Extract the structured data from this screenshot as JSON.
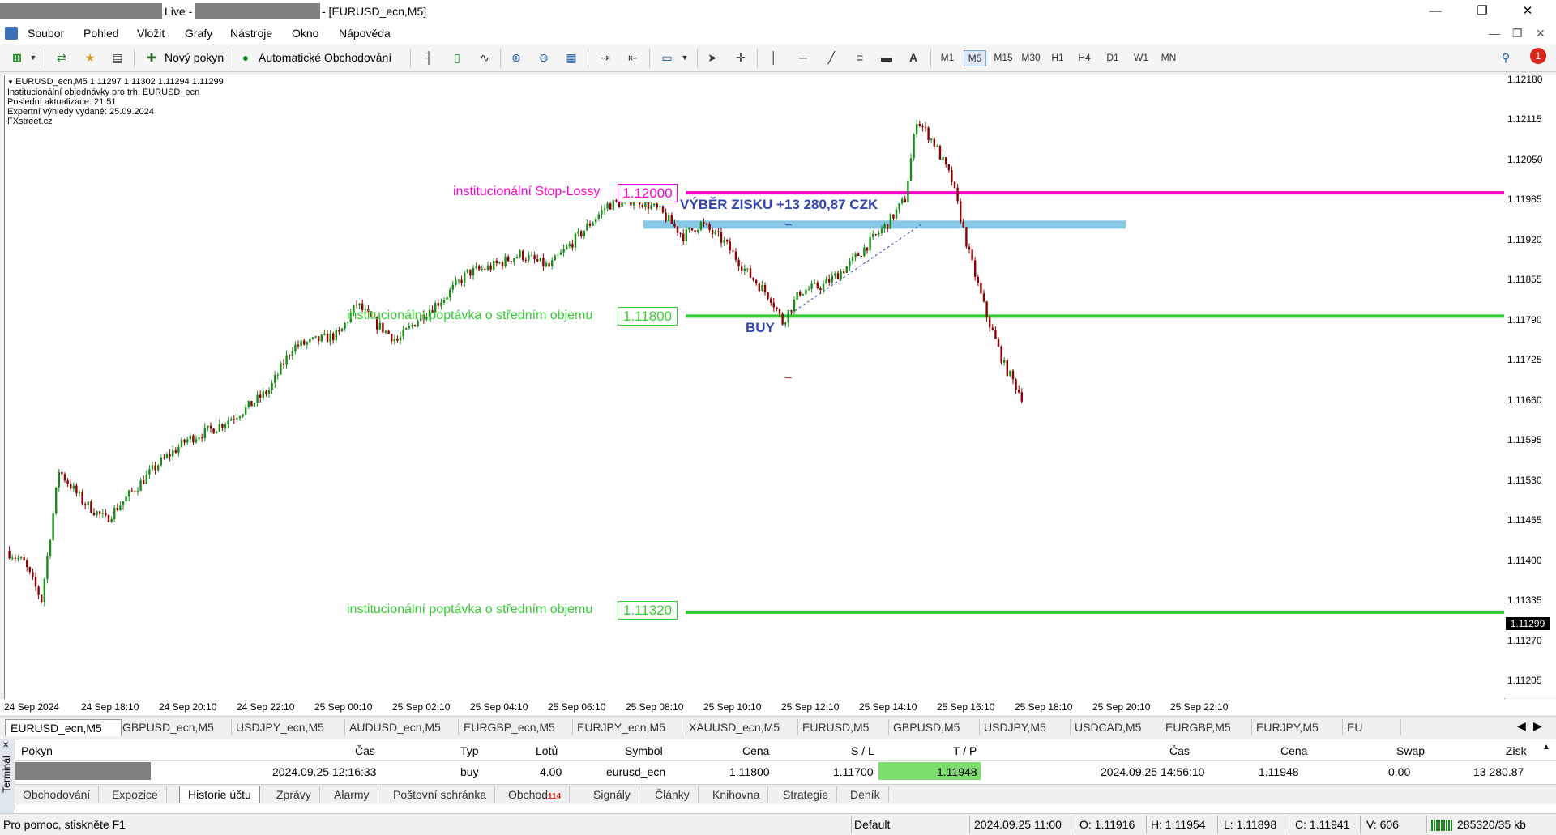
{
  "window": {
    "title_prefix": "Live - ",
    "title_suffix": " - [EURUSD_ecn,M5]",
    "minimize": "—",
    "maximize": "❐",
    "close": "✕"
  },
  "menu": [
    "Soubor",
    "Pohled",
    "Vložit",
    "Grafy",
    "Nástroje",
    "Okno",
    "Nápověda"
  ],
  "toolbar": {
    "new_order": "Nový pokyn",
    "auto_trading": "Automatické Obchodování",
    "timeframes": [
      "M1",
      "M5",
      "M15",
      "M30",
      "H1",
      "H4",
      "D1",
      "W1",
      "MN"
    ],
    "active_timeframe": "M5",
    "notification_count": "1",
    "text_tool": "A"
  },
  "chart": {
    "info_line1": "EURUSD_ecn,M5  1.11297 1.11302 1.11294 1.11299",
    "info_line2": "Institucionální objednávky pro trh: EURUSD_ecn",
    "info_line3": "Poslední aktualizace: 21:51",
    "info_line4": "Expertní výhledy vydané: 25.09.2024",
    "info_line5": "FXstreet.cz",
    "level_stoploss_label": "institucionální Stop-Lossy",
    "level_stoploss_price": "1.12000",
    "level_demand1_label": "institucionální poptávka o středním objemu",
    "level_demand1_price": "1.11800",
    "level_demand2_label": "institucionální poptávka o středním objemu",
    "level_demand2_price": "1.11320",
    "profit_label": "VÝBĚR ZISKU +13 280,87 CZK",
    "buy_label": "BUY",
    "current_price": "1.11299",
    "price_ticks": [
      "1.12180",
      "1.12115",
      "1.12050",
      "1.11985",
      "1.11920",
      "1.11855",
      "1.11790",
      "1.11725",
      "1.11660",
      "1.11595",
      "1.11530",
      "1.11465",
      "1.11400",
      "1.11335",
      "1.11270",
      "1.11205"
    ],
    "time_ticks": [
      "24 Sep 2024",
      "24 Sep 18:10",
      "24 Sep 20:10",
      "24 Sep 22:10",
      "25 Sep 00:10",
      "25 Sep 02:10",
      "25 Sep 04:10",
      "25 Sep 06:10",
      "25 Sep 08:10",
      "25 Sep 10:10",
      "25 Sep 12:10",
      "25 Sep 14:10",
      "25 Sep 16:10",
      "25 Sep 18:10",
      "25 Sep 20:10",
      "25 Sep 22:10"
    ],
    "colors": {
      "stoploss": "#ff00cc",
      "demand": "#33cc33",
      "profit_band": "#87c8e6",
      "profit_text": "#3344aa",
      "bull": "#1a8a1a",
      "bear": "#8b0000"
    }
  },
  "symbol_tabs": [
    "EURUSD_ecn,M5",
    "GBPUSD_ecn,M5",
    "USDJPY_ecn,M5",
    "AUDUSD_ecn,M5",
    "EURGBP_ecn,M5",
    "EURJPY_ecn,M5",
    "XAUUSD_ecn,M5",
    "EURUSD,M5",
    "GBPUSD,M5",
    "USDJPY,M5",
    "USDCAD,M5",
    "EURGBP,M5",
    "EURJPY,M5",
    "EU"
  ],
  "terminal": {
    "label": "Terminál",
    "headers": {
      "ticket": "Pokyn",
      "time": "Čas",
      "type": "Typ",
      "lots": "Lotů",
      "symbol": "Symbol",
      "price": "Cena",
      "sl": "S / L",
      "tp": "T / P",
      "close_time": "Čas",
      "close_price": "Cena",
      "swap": "Swap",
      "profit": "Zisk"
    },
    "row": {
      "time": "2024.09.25 12:16:33",
      "type": "buy",
      "lots": "4.00",
      "symbol": "eurusd_ecn",
      "price": "1.11800",
      "sl": "1.11700",
      "tp": "1.11948",
      "close_time": "2024.09.25 14:56:10",
      "close_price": "1.11948",
      "swap": "0.00",
      "profit": "13 280.87"
    },
    "tabs": [
      "Obchodování",
      "Expozice",
      "Historie účtu",
      "Zprávy",
      "Alarmy",
      "Poštovní schránka",
      "Obchod",
      "Signály",
      "Články",
      "Knihovna",
      "Strategie",
      "Deník"
    ],
    "trade_badge": "114",
    "active_tab": "Historie účtu"
  },
  "status": {
    "help": "Pro pomoc, stiskněte F1",
    "profile": "Default",
    "datetime": "2024.09.25 11:00",
    "open": "O: 1.11916",
    "high": "H: 1.11954",
    "low": "L: 1.11898",
    "close": "C: 1.11941",
    "volume": "V: 606",
    "traffic": "285320/35 kb"
  }
}
